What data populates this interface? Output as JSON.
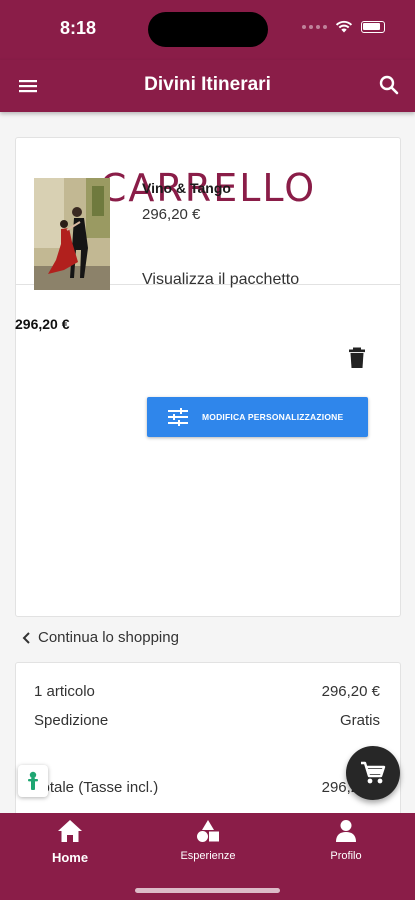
{
  "status_bar": {
    "time": "8:18"
  },
  "app_bar": {
    "title": "Divini Itinerari",
    "menu_icon": "hamburger-icon",
    "search_icon": "search-icon"
  },
  "cart": {
    "heading": "CARRELLO",
    "item": {
      "name": "Vino & Tango",
      "price": "296,20 €",
      "view_link": "Visualizza il pacchetto",
      "line_total": "296,20 €"
    },
    "customize_button": "MODIFICA PERSONALIZZAZIONE",
    "continue_shopping": "Continua lo shopping"
  },
  "summary": {
    "items_label": "1 articolo",
    "items_value": "296,20 €",
    "shipping_label": "Spedizione",
    "shipping_value": "Gratis",
    "total_label": "Totale (Tasse incl.)",
    "total_value": "296,20 €"
  },
  "bottom_nav": [
    {
      "label": "Home",
      "icon": "home-icon",
      "active": true
    },
    {
      "label": "Esperienze",
      "icon": "shapes-icon",
      "active": false
    },
    {
      "label": "Profilo",
      "icon": "person-icon",
      "active": false
    }
  ],
  "colors": {
    "brand": "#8a1d48",
    "button": "#2f86eb",
    "fab": "#272727"
  }
}
